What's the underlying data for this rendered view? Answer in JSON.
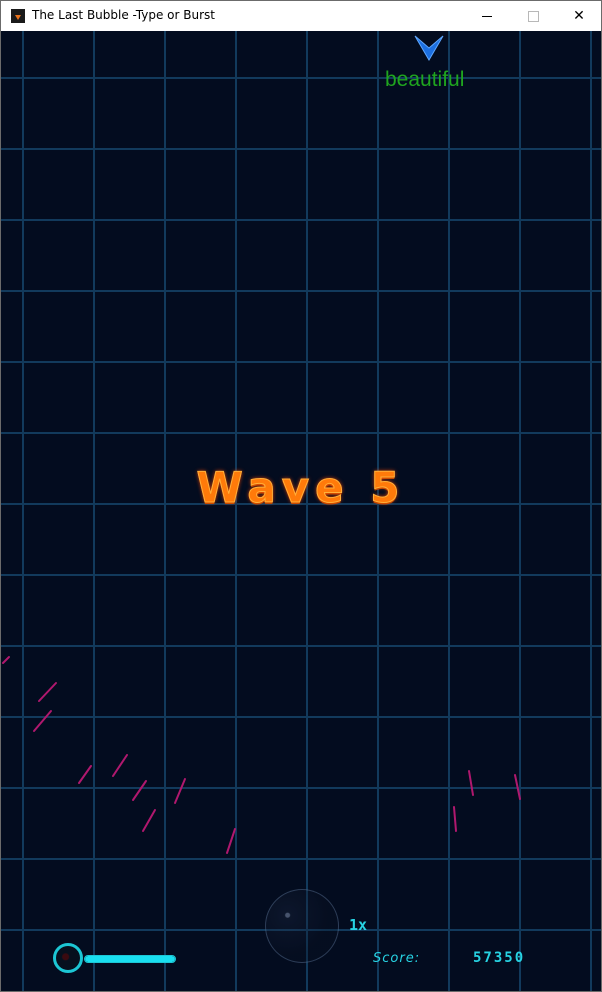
{
  "window": {
    "title": "The Last Bubble -Type or Burst",
    "minimize_label": "",
    "maximize_label": "",
    "close_label": "✕"
  },
  "game": {
    "enemy_word": "beautiful",
    "wave_title": "Wave 5",
    "multiplier": "1x",
    "score_label": "Score:",
    "score_value": "57350",
    "health_fraction": 1.0
  },
  "colors": {
    "background": "#030c1f",
    "grid": "#123a5c",
    "wave_title": "#ff7a0a",
    "hud_cyan": "#27d3e3",
    "enemy_word": "#1fa51f",
    "enemy_ship": "#1c6fe0",
    "sparks": "#b0186e"
  }
}
